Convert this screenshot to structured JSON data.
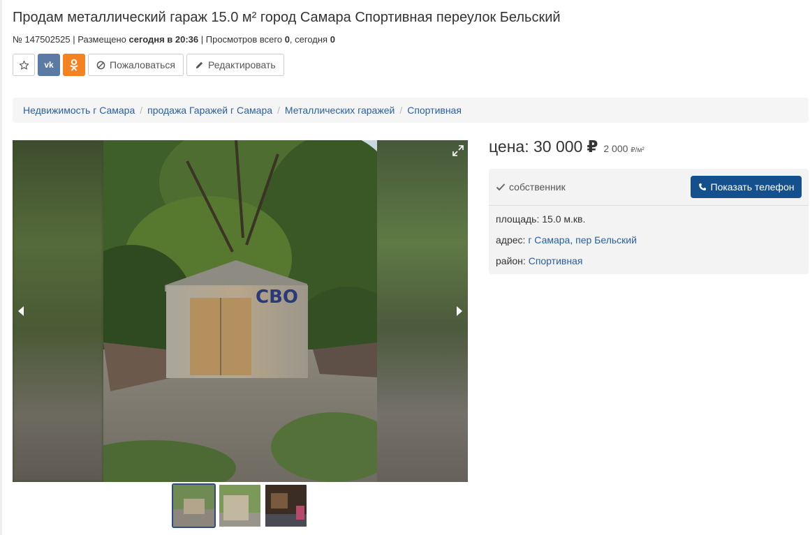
{
  "listing": {
    "title": "Продам металлический гараж 15.0 м² город Самара Спортивная переулок Бельский",
    "id_text": "№ 147502525",
    "posted_label": "Размещено",
    "posted_value": "сегодня в 20:36",
    "views_label": "Просмотров всего",
    "views_total": "0",
    "views_today_label": "сегодня",
    "views_today": "0"
  },
  "actions": {
    "favorite_icon": "star-icon",
    "vk_label": "vk",
    "ok_icon": "odnoklassniki-icon",
    "complain_label": "Пожаловаться",
    "edit_label": "Редактировать"
  },
  "breadcrumb": [
    "Недвижимость г Самара",
    "продажа Гаражей г Самара",
    "Металлических гаражей",
    "Спортивная"
  ],
  "price": {
    "label": "цена:",
    "value": "30 000",
    "currency": "₽",
    "per_m2": "2 000",
    "per_m2_unit_currency": "₽",
    "per_m2_unit": "/м²"
  },
  "details": {
    "seller_type": "собственник",
    "phone_button": "Показать телефон",
    "area_label": "площадь:",
    "area_value": "15.0 м.кв.",
    "address_label": "адрес:",
    "address_city": "г Самара",
    "address_street": "пер Бельский",
    "district_label": "район:",
    "district_value": "Спортивная"
  },
  "gallery": {
    "photo_count": 3,
    "active_index": 0,
    "graffiti_text": "СВО"
  },
  "colors": {
    "link": "#2a5f9e",
    "primary_button": "#15508e",
    "vk": "#5b7aa4",
    "ok": "#f58220"
  }
}
